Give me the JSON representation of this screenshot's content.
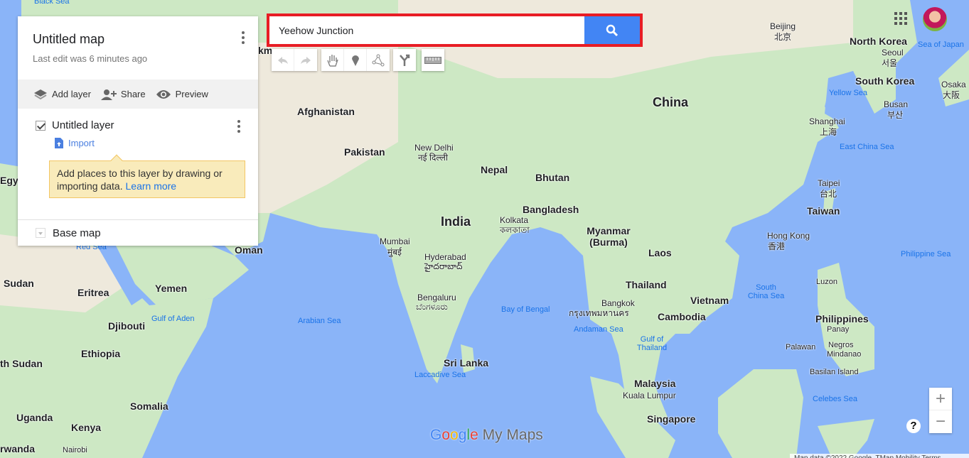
{
  "panel": {
    "title": "Untitled map",
    "last_edit": "Last edit was 6 minutes ago",
    "actions": {
      "add_layer": "Add layer",
      "share": "Share",
      "preview": "Preview"
    },
    "layer": {
      "name": "Untitled layer",
      "checked": true,
      "import": "Import"
    },
    "tip": {
      "text": "Add places to this layer by drawing or importing data.",
      "link": "Learn more"
    },
    "base_map": "Base map"
  },
  "search": {
    "value": "Yeehow Junction"
  },
  "toolbar": [
    "undo-icon",
    "redo-icon",
    "hand-icon",
    "marker-icon",
    "line-icon",
    "directions-icon",
    "ruler-icon"
  ],
  "zoom": {
    "in": "+",
    "out": "−"
  },
  "help": "?",
  "logo": {
    "google": "Google",
    "mymaps": "My Maps"
  },
  "attribution": "Map data ©2022 Google, TMap Mobility   Terms",
  "colors": {
    "search_highlight": "#e81d25",
    "search_button": "#4285f4",
    "water": "#8ab4f8",
    "land": "#a8dab5"
  },
  "map_labels": {
    "countries": [
      "China",
      "India",
      "Afghanistan",
      "Pakistan",
      "Nepal",
      "Bhutan",
      "Bangladesh",
      "Myanmar (Burma)",
      "Laos",
      "Thailand",
      "Vietnam",
      "Cambodia",
      "Malaysia",
      "Singapore",
      "Sri Lanka",
      "Philippines",
      "Taiwan",
      "North Korea",
      "South Korea",
      "Yemen",
      "Eritrea",
      "Djibouti",
      "Ethiopia",
      "Somalia",
      "Kenya",
      "Uganda",
      "Sudan",
      "th Sudan",
      "rwanda",
      "Egy",
      "Oman",
      "km"
    ],
    "cities": [
      "Beijing",
      "北京",
      "Seoul",
      "서울",
      "Busan",
      "부산",
      "Osaka",
      "大阪",
      "Shanghai",
      "上海",
      "Taipei",
      "台北",
      "Hong Kong",
      "香港",
      "New Delhi",
      "नई दिल्ली",
      "Kolkata",
      "কলকাতা",
      "Mumbai",
      "मुंबई",
      "Hyderabad",
      "హైదరాబాద్",
      "Bengaluru",
      "ಬೆಂಗಳೂರು",
      "Bangkok",
      "กรุงเทพมหานคร",
      "Kuala Lumpur",
      "Panay",
      "Negros",
      "Mindanao",
      "Palawan",
      "Luzon",
      "Basilan Island",
      "Nairobi"
    ],
    "seas": [
      "Sea of Japan",
      "Yellow Sea",
      "East China Sea",
      "Philippine Sea",
      "South China Sea",
      "Bay of Bengal",
      "Arabian Sea",
      "Andaman Sea",
      "Gulf of Thailand",
      "Laccadive Sea",
      "Gulf of Aden",
      "Red Sea",
      "Celebes Sea",
      "Black Sea"
    ]
  }
}
